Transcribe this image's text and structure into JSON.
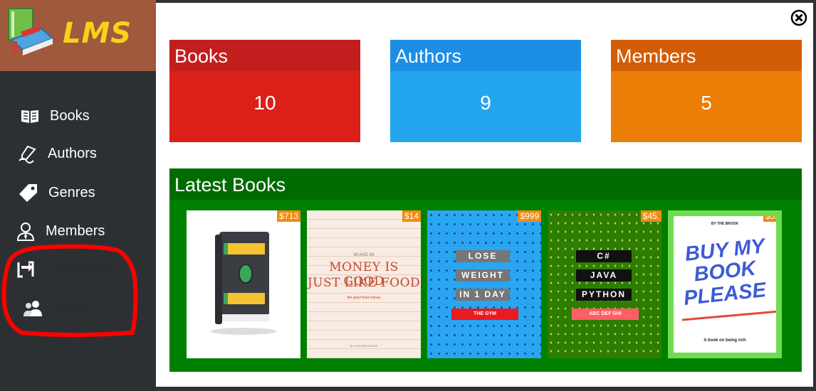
{
  "app": {
    "logo_text": "LMS"
  },
  "sidebar": {
    "items": [
      {
        "label": "Books",
        "icon": "book-open-icon"
      },
      {
        "label": "Authors",
        "icon": "pen-signature-icon"
      },
      {
        "label": "Genres",
        "icon": "tag-icon"
      },
      {
        "label": "Members",
        "icon": "user-tie-icon"
      },
      {
        "label": "Circulation",
        "icon": "exchange-icon"
      },
      {
        "label": "Users",
        "icon": "users-icon"
      }
    ]
  },
  "stats": {
    "books": {
      "label": "Books",
      "value": "10"
    },
    "authors": {
      "label": "Authors",
      "value": "9"
    },
    "members": {
      "label": "Members",
      "value": "5"
    }
  },
  "latest": {
    "title": "Latest Books",
    "books": [
      {
        "price": "$713"
      },
      {
        "price": "$14",
        "cover_small": "MI AND MI",
        "cover_title_1": "MONEY IS GOOD",
        "cover_title_2": "JUST LIKE FOOD",
        "cover_sub": "the good food money",
        "cover_author": "BY AUTHOR BOOKS"
      },
      {
        "price": "$999",
        "line1": "LOSE",
        "line2": "WEIGHT",
        "line3": "IN 1 DAY",
        "tag": "THE GYM"
      },
      {
        "price": "$45.",
        "line1": "C#",
        "line2": "JAVA",
        "line3": "PYTHON",
        "tag": "ABC DEF GHI"
      },
      {
        "price": "$55",
        "byline": "BY THE BROOK",
        "t1": "BUY MY",
        "t2": "BOOK",
        "t3": "PLEASE",
        "tagline": "A book on being rich"
      }
    ]
  },
  "colors": {
    "books": "#db1f19",
    "authors": "#24a6ee",
    "members": "#ea7e06",
    "latest": "#008000",
    "annotation": "#ff0000"
  }
}
